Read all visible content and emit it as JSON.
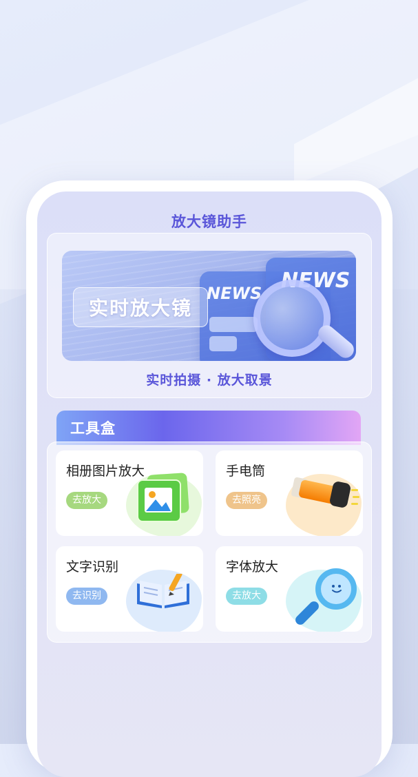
{
  "app": {
    "title": "放大镜助手"
  },
  "hero": {
    "banner_title": "实时放大镜",
    "banner_art_text": [
      "NEWS",
      "NEWS"
    ],
    "subtitle": "实时拍摄 · 放大取景"
  },
  "toolbox": {
    "title": "工具盒",
    "tools": [
      {
        "label": "相册图片放大",
        "action": "去放大",
        "pill_color": "#a6d87f",
        "blob_color": "#e7f8dc",
        "icon": "photo-album-icon"
      },
      {
        "label": "手电筒",
        "action": "去照亮",
        "pill_color": "#efc48b",
        "blob_color": "#fde9c9",
        "icon": "flashlight-icon"
      },
      {
        "label": "文字识别",
        "action": "去识别",
        "pill_color": "#8fb8f0",
        "blob_color": "#deebfc",
        "icon": "open-book-pencil-icon"
      },
      {
        "label": "字体放大",
        "action": "去放大",
        "pill_color": "#8edde6",
        "blob_color": "#d6f4f7",
        "icon": "magnifier-icon"
      }
    ]
  },
  "colors": {
    "accent": "#5a56d9",
    "page_bg": "#e3e8f8"
  }
}
